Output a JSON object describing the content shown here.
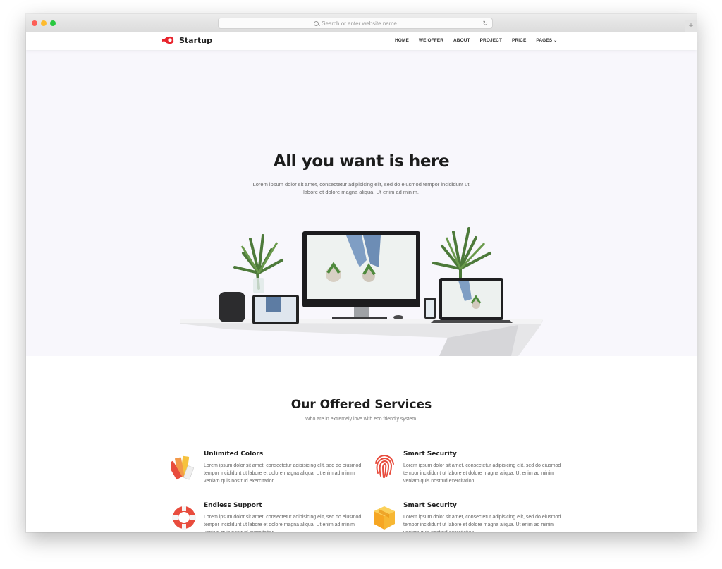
{
  "browser": {
    "address_placeholder": "Search or enter website name",
    "newtab_label": "+"
  },
  "site": {
    "brand": "Startup",
    "brand_color": "#e8242d",
    "nav": [
      {
        "label": "HOME"
      },
      {
        "label": "WE OFFER"
      },
      {
        "label": "ABOUT"
      },
      {
        "label": "PROJECT"
      },
      {
        "label": "PRICE"
      },
      {
        "label": "PAGES",
        "has_dropdown": true
      }
    ]
  },
  "hero": {
    "title": "All you want is here",
    "subtitle": "Lorem ipsum dolor sit amet, consectetur adipisicing elit, sed do eiusmod tempor incididunt ut labore et dolore magna aliqua. Ut enim ad minim.",
    "background": "#f8f7fc"
  },
  "services": {
    "title": "Our Offered Services",
    "subtitle": "Who are in extremely love with eco friendly system.",
    "items": [
      {
        "title": "Unlimited Colors",
        "icon": "color-swatch-icon",
        "text": "Lorem ipsum dolor sit amet, consectetur adipisicing elit, sed do eiusmod tempor incididunt ut labore et dolore magna aliqua. Ut enim ad minim veniam quis nostrud exercitation."
      },
      {
        "title": "Smart Security",
        "icon": "fingerprint-icon",
        "text": "Lorem ipsum dolor sit amet, consectetur adipisicing elit, sed do eiusmod tempor incididunt ut labore et dolore magna aliqua. Ut enim ad minim veniam quis nostrud exercitation."
      },
      {
        "title": "Endless Support",
        "icon": "lifebuoy-icon",
        "text": "Lorem ipsum dolor sit amet, consectetur adipisicing elit, sed do eiusmod tempor incididunt ut labore et dolore magna aliqua. Ut enim ad minim veniam quis nostrud exercitation."
      },
      {
        "title": "Smart Security",
        "icon": "box-icon",
        "text": "Lorem ipsum dolor sit amet, consectetur adipisicing elit, sed do eiusmod tempor incididunt ut labore et dolore magna aliqua. Ut enim ad minim veniam quis nostrud exercitation."
      }
    ]
  }
}
